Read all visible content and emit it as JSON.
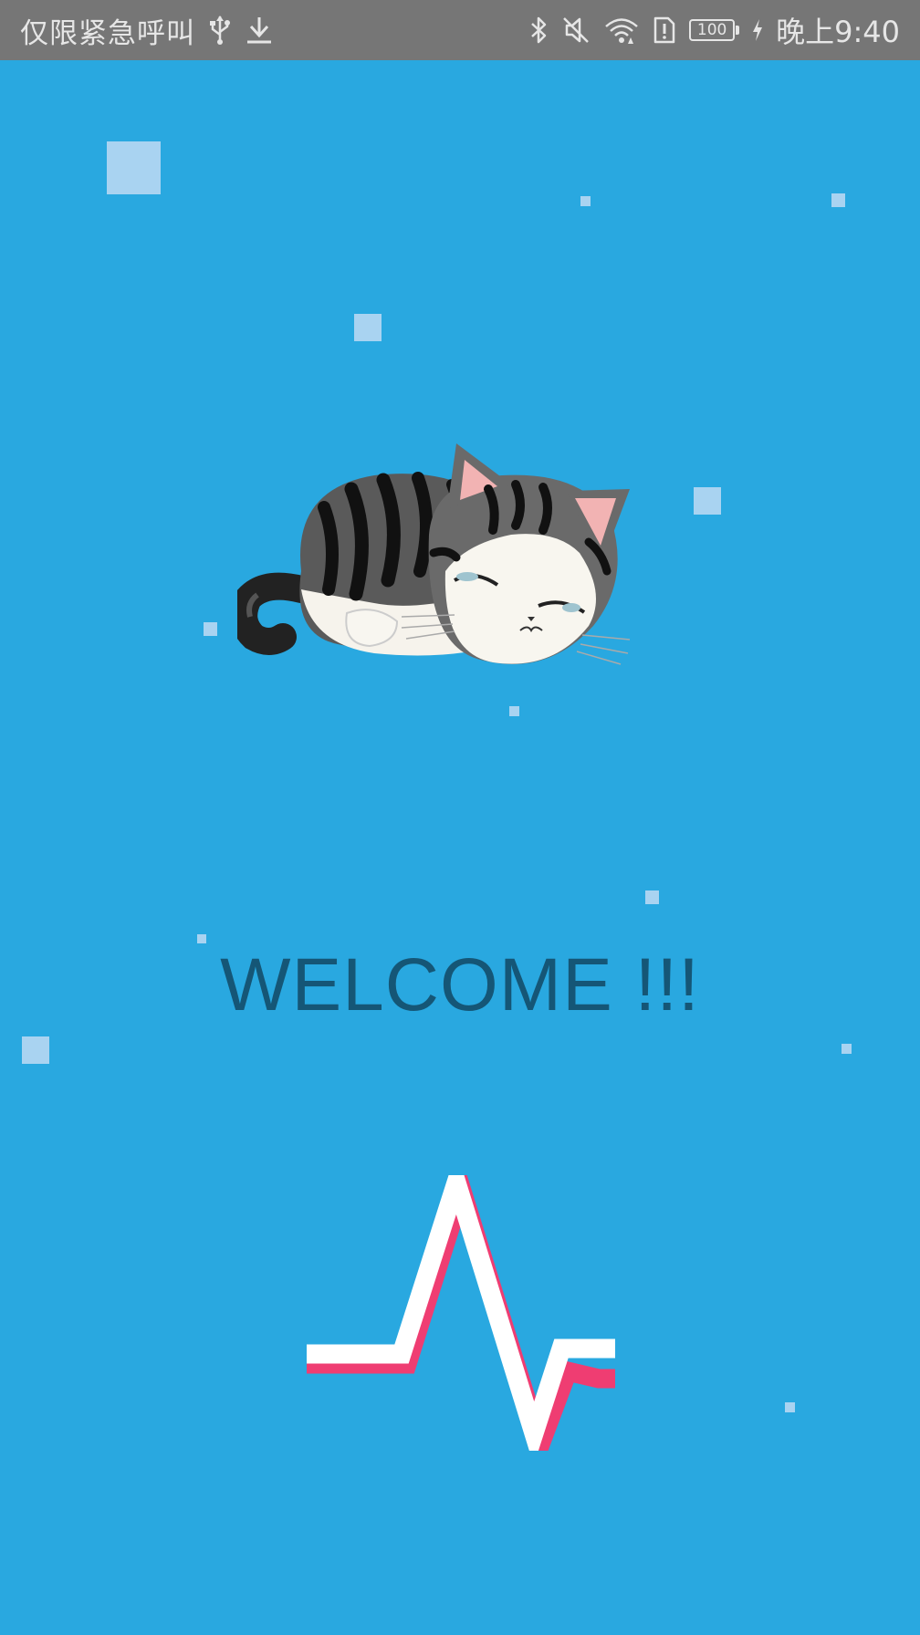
{
  "status_bar": {
    "carrier": "仅限紧急呼叫",
    "battery_level": "100",
    "time": "晚上9:40",
    "icons": [
      "usb-icon",
      "download-icon",
      "bluetooth-icon",
      "mute-icon",
      "wifi-icon",
      "alert-icon",
      "battery-icon",
      "charging-icon"
    ]
  },
  "main": {
    "welcome_text": "WELCOME !!!"
  },
  "colors": {
    "background": "#29a8e0",
    "status_bar": "#767676",
    "welcome_text": "#155676",
    "particle": "#a9d3f1",
    "logo_white": "#ffffff",
    "logo_pink": "#ef3d72"
  },
  "images": {
    "cat": "sleeping-cat-illustration",
    "logo": "heartbeat-pulse-logo"
  }
}
